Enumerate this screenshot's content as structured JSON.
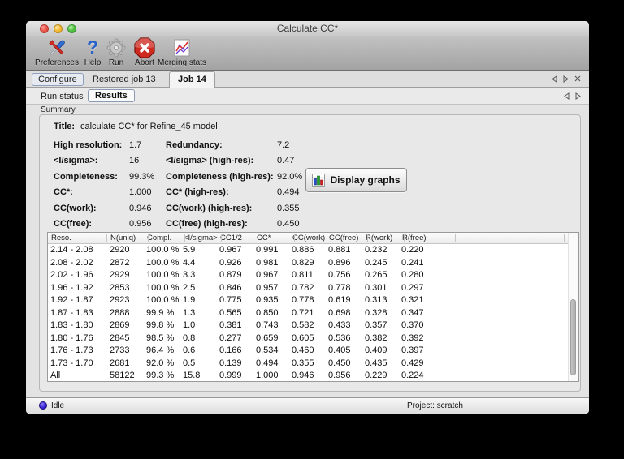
{
  "window_title": "Calculate CC*",
  "traffic_lights": [
    "close",
    "minimize",
    "zoom"
  ],
  "toolbar": {
    "items": [
      {
        "name": "preferences",
        "label": "Preferences",
        "icon": "tools-icon"
      },
      {
        "name": "help",
        "label": "Help",
        "icon": "question-mark-icon"
      },
      {
        "name": "run",
        "label": "Run",
        "icon": "gear-icon"
      },
      {
        "name": "abort",
        "label": "Abort",
        "icon": "stop-x-icon"
      },
      {
        "name": "merging_stats",
        "label": "Merging stats",
        "icon": "merging-graph-icon"
      }
    ]
  },
  "tabs": {
    "items": [
      {
        "label": "Configure",
        "active": false
      },
      {
        "label": "Restored job 13",
        "active": false
      },
      {
        "label": "Job 14",
        "active": true
      }
    ]
  },
  "subtabs": {
    "items": [
      {
        "label": "Run status",
        "active": false
      },
      {
        "label": "Results",
        "active": true
      }
    ]
  },
  "summary_section_label": "Summary",
  "summary": {
    "title_label": "Title:",
    "title_value": "calculate CC* for Refine_45 model",
    "rows": [
      {
        "l1": "High resolution:",
        "v1": "1.7",
        "l2": "Redundancy:",
        "v2": "7.2"
      },
      {
        "l1": "<I/sigma>:",
        "v1": "16",
        "l2": "<I/sigma> (high-res):",
        "v2": "0.47"
      },
      {
        "l1": "Completeness:",
        "v1": "99.3%",
        "l2": "Completeness (high-res):",
        "v2": "92.0%"
      },
      {
        "l1": "CC*:",
        "v1": "1.000",
        "l2": "CC* (high-res):",
        "v2": "0.494"
      },
      {
        "l1": "CC(work):",
        "v1": "0.946",
        "l2": "CC(work) (high-res):",
        "v2": "0.355"
      },
      {
        "l1": "CC(free):",
        "v1": "0.956",
        "l2": "CC(free) (high-res):",
        "v2": "0.450"
      }
    ],
    "display_graphs_label": "Display graphs"
  },
  "results_table": {
    "columns": [
      "Reso.",
      "N(uniq)",
      "Compl.",
      "<I/sigma>",
      "CC1/2",
      "CC*",
      "CC(work)",
      "CC(free)",
      "R(work)",
      "R(free)"
    ],
    "rows": [
      [
        "2.14 - 2.08",
        "2920",
        "100.0 %",
        "5.9",
        "0.967",
        "0.991",
        "0.886",
        "0.881",
        "0.232",
        "0.220"
      ],
      [
        "2.08 - 2.02",
        "2872",
        "100.0 %",
        "4.4",
        "0.926",
        "0.981",
        "0.829",
        "0.896",
        "0.245",
        "0.241"
      ],
      [
        "2.02 - 1.96",
        "2929",
        "100.0 %",
        "3.3",
        "0.879",
        "0.967",
        "0.811",
        "0.756",
        "0.265",
        "0.280"
      ],
      [
        "1.96 - 1.92",
        "2853",
        "100.0 %",
        "2.5",
        "0.846",
        "0.957",
        "0.782",
        "0.778",
        "0.301",
        "0.297"
      ],
      [
        "1.92 - 1.87",
        "2923",
        "100.0 %",
        "1.9",
        "0.775",
        "0.935",
        "0.778",
        "0.619",
        "0.313",
        "0.321"
      ],
      [
        "1.87 - 1.83",
        "2888",
        "99.9 %",
        "1.3",
        "0.565",
        "0.850",
        "0.721",
        "0.698",
        "0.328",
        "0.347"
      ],
      [
        "1.83 - 1.80",
        "2869",
        "99.8 %",
        "1.0",
        "0.381",
        "0.743",
        "0.582",
        "0.433",
        "0.357",
        "0.370"
      ],
      [
        "1.80 - 1.76",
        "2845",
        "98.5 %",
        "0.8",
        "0.277",
        "0.659",
        "0.605",
        "0.536",
        "0.382",
        "0.392"
      ],
      [
        "1.76 - 1.73",
        "2733",
        "96.4 %",
        "0.6",
        "0.166",
        "0.534",
        "0.460",
        "0.405",
        "0.409",
        "0.397"
      ],
      [
        "1.73 - 1.70",
        "2681",
        "92.0 %",
        "0.5",
        "0.139",
        "0.494",
        "0.355",
        "0.450",
        "0.435",
        "0.429"
      ],
      [
        "All",
        "58122",
        "99.3 %",
        "15.8",
        "0.999",
        "1.000",
        "0.946",
        "0.956",
        "0.229",
        "0.224"
      ]
    ]
  },
  "status_bar": {
    "status": "Idle",
    "project": "Project: scratch"
  },
  "colors": {
    "abort_red": "#c21f14",
    "help_blue": "#2a62c8",
    "idle_indigo": "#3d28d8",
    "bar_blue": "#2a50c8",
    "bar_green": "#1fa32a",
    "bar_red": "#cc2222"
  }
}
